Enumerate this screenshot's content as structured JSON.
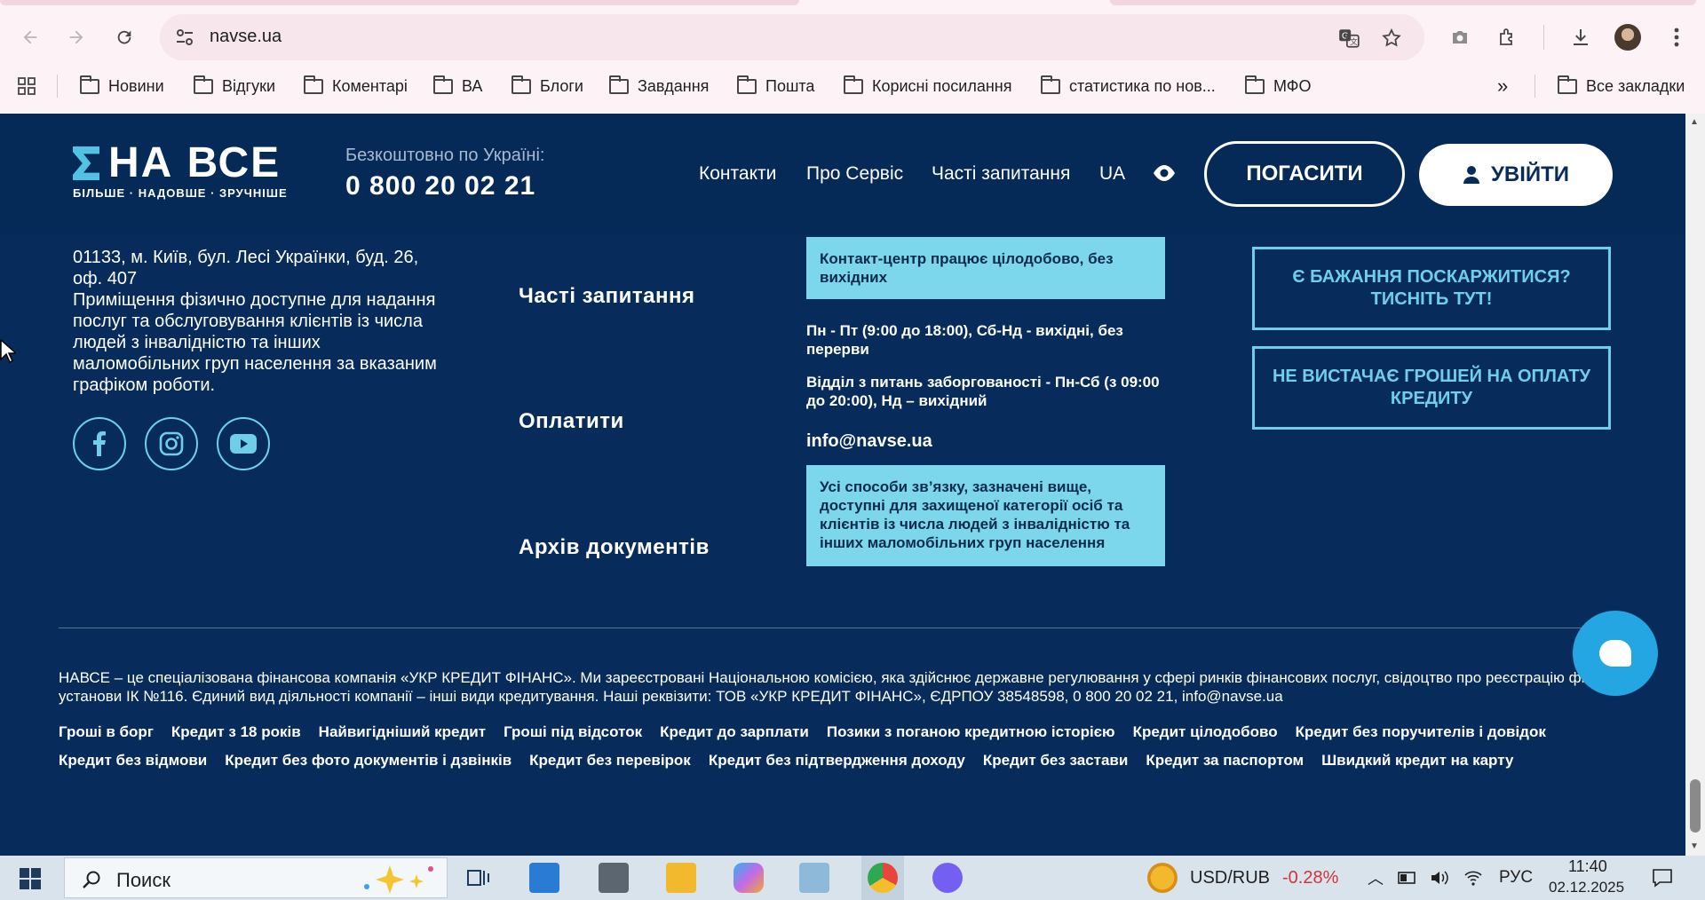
{
  "browser": {
    "url": "navse.ua",
    "bookmarks": [
      "Новини",
      "Відгуки",
      "Коментарі",
      "ВА",
      "Блоги",
      "Завдання",
      "Пошта",
      "Корисні посилання",
      "статистика по нов...",
      "МФО"
    ],
    "all_bookmarks": "Все закладки",
    "more": "»"
  },
  "header": {
    "logo_text": "НА ВСЕ",
    "logo_slogan": "БІЛЬШЕ · НАДОВШЕ · ЗРУЧНІШЕ",
    "hotline_label": "Безкоштовно по Україні:",
    "hotline_phone": "0 800 20 02 21",
    "nav": [
      "Контакти",
      "Про Сервіс",
      "Часті запитання",
      "UA"
    ],
    "pay_button": "ПОГАСИТИ",
    "login_button": "УВІЙТИ"
  },
  "footer": {
    "address": "01133, м. Київ, бул. Лесі Українки, буд. 26, оф. 407",
    "accessibility": "Приміщення фізично доступне для надання послуг та обслуговування клієнтів із числа людей з інвалідністю та інших маломобільних груп населення за вказаним графіком роботи.",
    "links": [
      "Часті запитання",
      "Оплатити",
      "Архів документів"
    ],
    "contact_center": "Контакт-центр працює цілодобово, без вихідних",
    "schedule": "Пн - Пт (9:00 до 18:00), Сб-Нд - вихідні, без перерви",
    "debt_dept": "Відділ з питань заборгованості - Пн-Сб (з 09:00 до 20:00), Нд – вихідний",
    "email": "info@navse.ua",
    "protected_note": "Усі способи зв’язку, зазначені вище, доступні для захищеної категорії осіб та клієнтів із числа людей з інвалідністю та інших маломобільних груп населення",
    "complaint_button": "Є БАЖАННЯ ПОСКАРЖИТИСЯ? ТИСНІТЬ ТУТ!",
    "no_money_button": "НЕ ВИСТАЧАЄ ГРОШЕЙ НА ОПЛАТУ КРЕДИТУ",
    "legal": "НАВСЕ – це спеціалізована фінансова компанія «УКР КРЕДИТ ФІНАНС». Ми зареєстровані Національною комісією, яка здійснює державне регулювання у сфері ринків фінансових послуг, свідоцтво про реєстрацію фінансової установи ІК №116. Єдиний вид діяльності компанії – інші види кредитування. Наші реквізити: ТОВ «УКР КРЕДИТ ФІНАНС», ЄДРПОУ 38548598, 0 800 20 02 21, info@navse.ua",
    "seo_row1": [
      "Гроші в борг",
      "Кредит з 18 років",
      "Найвигідніший кредит",
      "Гроші під відсоток",
      "Кредит до зарплати",
      "Позики з поганою кредитною історією",
      "Кредит цілодобово",
      "Кредит без поручителів і довідок"
    ],
    "seo_row2": [
      "Кредит без відмови",
      "Кредит без фото документів і дзвінків",
      "Кредит без перевірок",
      "Кредит без підтвердження доходу",
      "Кредит без застави",
      "Кредит за паспортом",
      "Швидкий кредит на карту"
    ]
  },
  "taskbar": {
    "search_placeholder": "Поиск",
    "currency": "USD/RUB",
    "currency_change": "-0.28%",
    "lang": "РУС",
    "time": "11:40",
    "date": "02.12.2025"
  },
  "colors": {
    "site_bg": "#072c5c",
    "accent_cyan": "#7cd6ec",
    "chat_blue": "#23a6e1"
  }
}
